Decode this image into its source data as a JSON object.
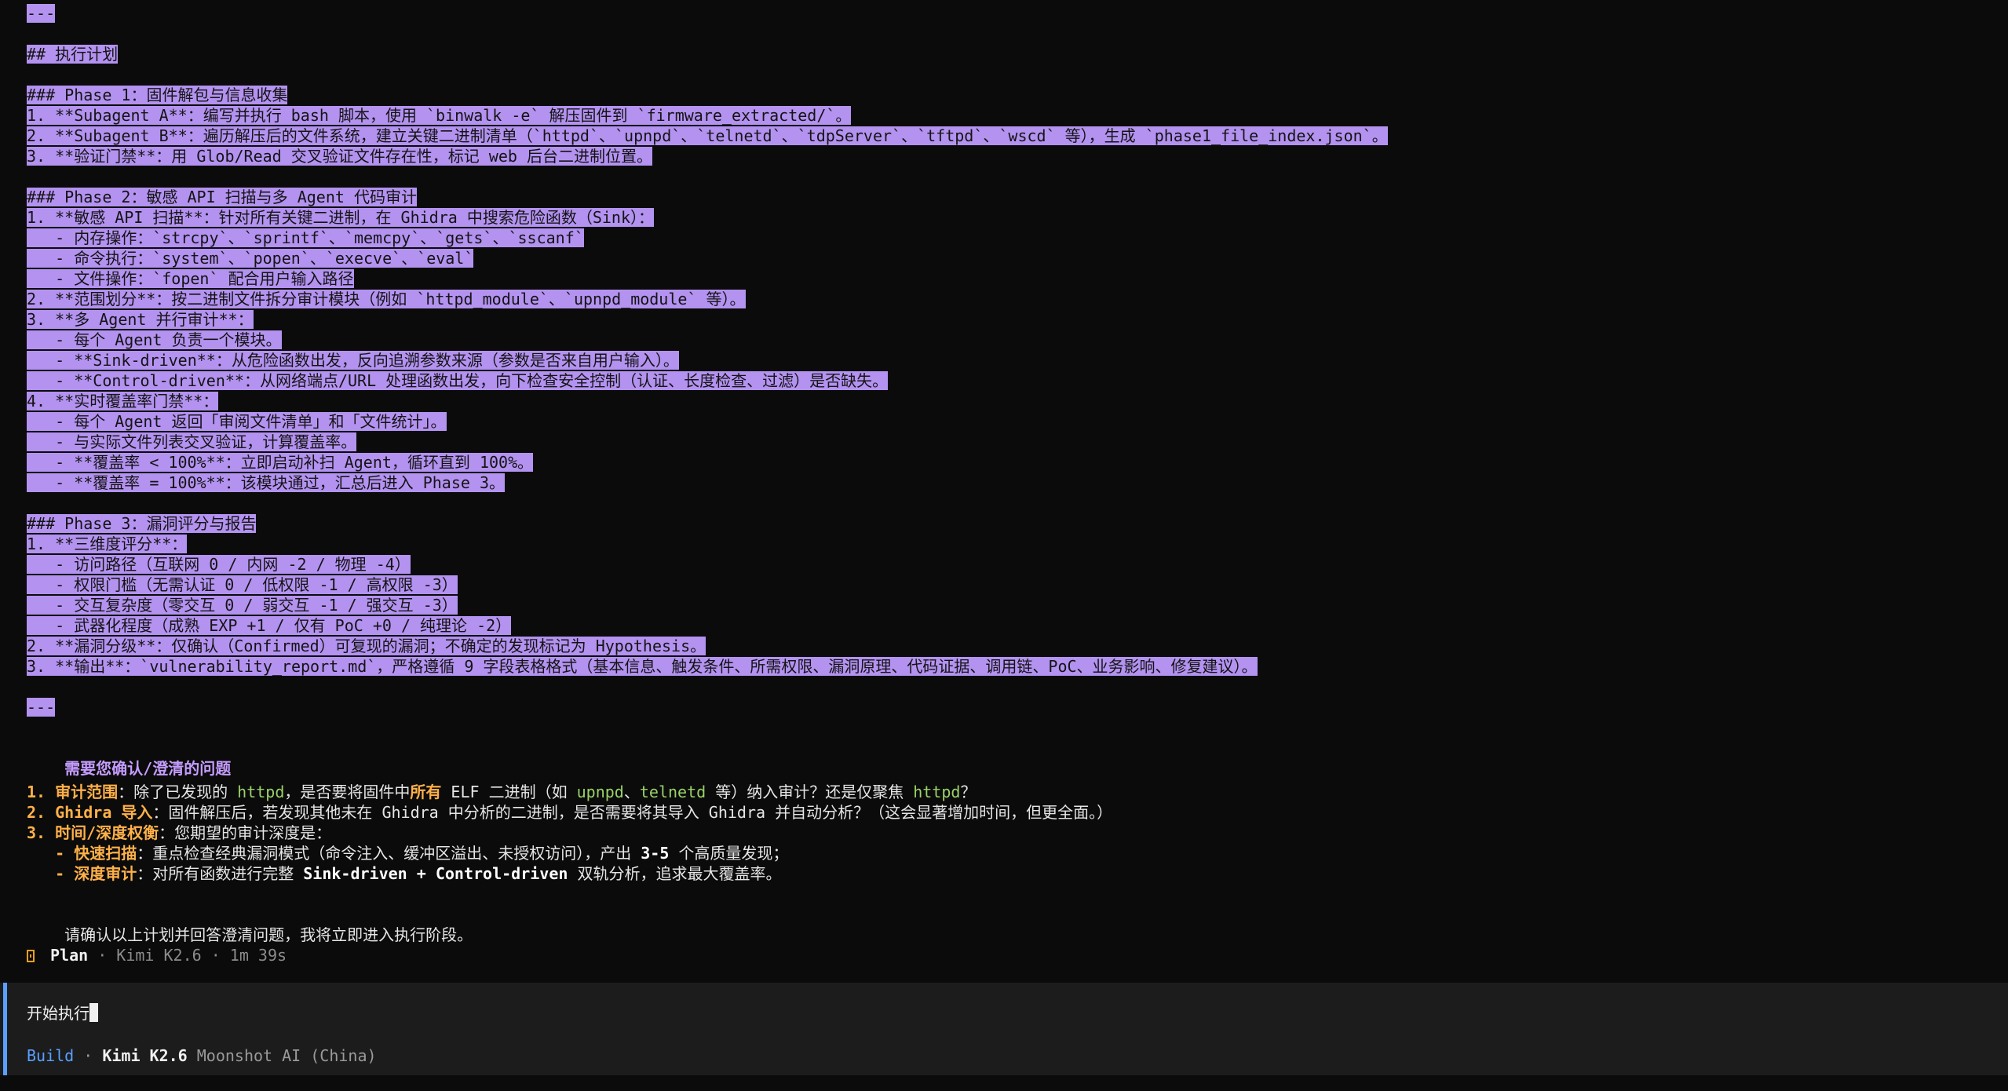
{
  "plan": {
    "lines": [
      "---",
      "",
      "## 执行计划",
      "",
      "### Phase 1：固件解包与信息收集",
      "1. **Subagent A**：编写并执行 bash 脚本，使用 `binwalk -e` 解压固件到 `firmware_extracted/`。",
      "2. **Subagent B**：遍历解压后的文件系统，建立关键二进制清单（`httpd`、`upnpd`、`telnetd`、`tdpServer`、`tftpd`、`wscd` 等），生成 `phase1_file_index.json`。",
      "3. **验证门禁**：用 Glob/Read 交叉验证文件存在性，标记 web 后台二进制位置。",
      "",
      "### Phase 2：敏感 API 扫描与多 Agent 代码审计",
      "1. **敏感 API 扫描**：针对所有关键二进制，在 Ghidra 中搜索危险函数（Sink）：",
      "   - 内存操作：`strcpy`、`sprintf`、`memcpy`、`gets`、`sscanf`",
      "   - 命令执行：`system`、`popen`、`execve`、`eval`",
      "   - 文件操作：`fopen` 配合用户输入路径",
      "2. **范围划分**：按二进制文件拆分审计模块（例如 `httpd_module`、`upnpd_module` 等）。",
      "3. **多 Agent 并行审计**：",
      "   - 每个 Agent 负责一个模块。",
      "   - **Sink-driven**：从危险函数出发，反向追溯参数来源（参数是否来自用户输入）。",
      "   - **Control-driven**：从网络端点/URL 处理函数出发，向下检查安全控制（认证、长度检查、过滤）是否缺失。",
      "4. **实时覆盖率门禁**：",
      "   - 每个 Agent 返回「审阅文件清单」和「文件统计」。",
      "   - 与实际文件列表交叉验证，计算覆盖率。",
      "   - **覆盖率 < 100%**：立即启动补扫 Agent，循环直到 100%。",
      "   - **覆盖率 = 100%**：该模块通过，汇总后进入 Phase 3。",
      "",
      "### Phase 3：漏洞评分与报告",
      "1. **三维度评分**：",
      "   - 访问路径（互联网 0 / 内网 -2 / 物理 -4）",
      "   - 权限门槛（无需认证 0 / 低权限 -1 / 高权限 -3）",
      "   - 交互复杂度（零交互 0 / 弱交互 -1 / 强交互 -3）",
      "   - 武器化程度（成熟 EXP +1 / 仅有 PoC +0 / 纯理论 -2）",
      "2. **漏洞分级**：仅确认（Confirmed）可复现的漏洞；不确定的发现标记为 Hypothesis。",
      "3. **输出**：`vulnerability_report.md`，严格遵循 9 字段表格格式（基本信息、触发条件、所需权限、漏洞原理、代码证据、调用链、PoC、业务影响、修复建议）。",
      "",
      "---"
    ]
  },
  "questions": {
    "title": "需要您确认/澄清的问题",
    "q1": {
      "num": "1. ",
      "label": "审计范围",
      "t1": "：除了已发现的 ",
      "httpd": "httpd",
      "t2": "，是否要将固件中",
      "all": "所有",
      "t3": " ELF 二进制（如 ",
      "upnpd": "upnpd",
      "sep": "、",
      "telnetd": "telnetd",
      "t4": " 等）纳入审计？还是仅聚焦 ",
      "httpd2": "httpd",
      "t5": "？"
    },
    "q2": {
      "num": "2. ",
      "label": "Ghidra 导入",
      "text": "：固件解压后，若发现其他未在 Ghidra 中分析的二进制，是否需要将其导入 Ghidra 并自动分析？（这会显著增加时间，但更全面。）"
    },
    "q3": {
      "num": "3. ",
      "label": "时间/深度权衡",
      "text": "：您期望的审计深度是："
    },
    "q3a": {
      "prefix": "   - ",
      "label": "快速扫描",
      "t1": "：重点检查经典漏洞模式（命令注入、缓冲区溢出、未授权访问），产出 ",
      "count": "3-5",
      "t2": " 个高质量发现；"
    },
    "q3b": {
      "prefix": "   - ",
      "label": "深度审计",
      "t1": "：对所有函数进行完整 ",
      "mode": "Sink-driven + Control-driven",
      "t2": " 双轨分析，追求最大覆盖率。"
    },
    "confirm": "请确认以上计划并回答澄清问题，我将立即进入执行阶段。"
  },
  "status": {
    "icon": "plan-icon",
    "mode": "Plan",
    "sep1": " · ",
    "model": "Kimi K2.6",
    "sep2": " · ",
    "duration": "1m 39s"
  },
  "input": {
    "value": "开始执行"
  },
  "footer": {
    "mode": "Build",
    "sep": " · ",
    "model": "Kimi K2.6",
    "provider": " Moonshot AI (China)"
  },
  "colors": {
    "selection": "#b392f0",
    "accent": "#c59cff",
    "orange": "#ffb14a",
    "green": "#9ad26a",
    "build": "#5aa0ff"
  }
}
